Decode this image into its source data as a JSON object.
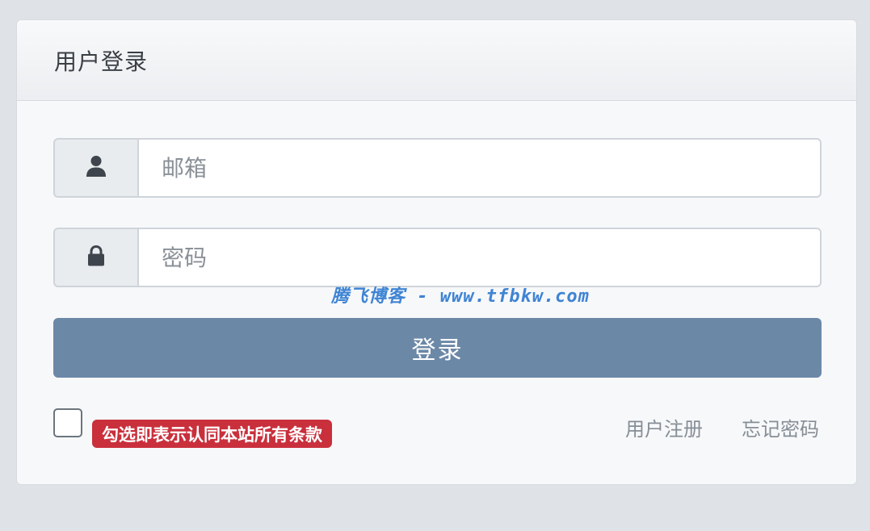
{
  "card": {
    "title": "用户登录"
  },
  "form": {
    "email": {
      "placeholder": "邮箱",
      "value": "",
      "icon": "user-icon"
    },
    "password": {
      "placeholder": "密码",
      "value": "",
      "icon": "lock-icon"
    },
    "submit_label": "登录",
    "agree_checked": false,
    "terms_label": "勾选即表示认同本站所有条款"
  },
  "links": {
    "register": "用户注册",
    "forgot_password": "忘记密码"
  },
  "watermark": "腾飞博客 - www.tfbkw.com",
  "colors": {
    "page_background": "#dfe2e6",
    "card_background": "#f7f8fa",
    "button": "#6c88a7",
    "terms_badge": "#c9303c",
    "watermark": "#3f84d4",
    "link": "#868e96"
  }
}
